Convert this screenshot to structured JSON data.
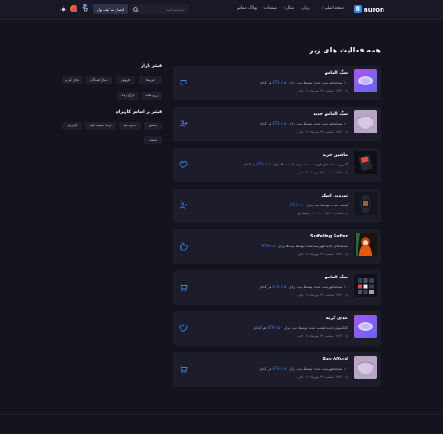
{
  "header": {
    "logo_letter": "N",
    "logo_text": "nuron",
    "nav": [
      "صفحه اصلی",
      "درباره",
      "مثال",
      "صفحات",
      "وبلاگ",
      "تماس"
    ],
    "search_placeholder": "جستجو بکنید",
    "wallet_button": "اتصال به کیف پول",
    "cart_count": "0"
  },
  "page_title": "همه فعالیت های زیر",
  "activities": [
    {
      "title": "سگ الماس",
      "desc_pre": "۱۰ نسخه فهرست شده توسط بیت برای ",
      "price": "ETH ۲.۵۰",
      "desc_post": " هر کدام",
      "date": "۲۹ مهرماه",
      "time": "۱۹:۳۰ دسامبر",
      "user": "جانی",
      "icon": "chat-icon"
    },
    {
      "title": "سگ الماس جدید",
      "desc_pre": "۱۰ نسخه فهرست شده توسط بیت برای ",
      "price": "ETH ۲.۵۰",
      "desc_post": " هر کدام",
      "date": "۲۹ مهرماه",
      "time": "۱۹:۳۰ دسامبر",
      "user": "جانی",
      "icon": "add-user-icon"
    },
    {
      "title": "ماشین خرید",
      "desc_pre": "آخرین نسخه های فهرست شده توسط بیت ها برای ",
      "price": "ETH ۲.۵۰",
      "desc_post": " هر کدام",
      "date": "۲۹ مهرماه",
      "time": "۱۹:۳۰ دسامبر",
      "user": "جانی",
      "icon": "heart-icon"
    },
    {
      "title": "توروین اسکر",
      "desc_pre": "لیست شده توسط بیت برای ",
      "price": "ETH ۲.۵۰",
      "desc_post": "",
      "date": "ساعت ۲۰ آبان ۱۴۰۰",
      "time": "",
      "user": "جانیسر تو",
      "icon": "add-user-icon"
    },
    {
      "title": "Suffeling Saffer",
      "desc_pre": "نسخه‌های جدید فهرست‌شده توسط بیت‌ها برای ",
      "price": "ETH ۲.۵۰",
      "desc_post": "",
      "date": "۲۹ مهرماه",
      "time": "۱۹:۳۰ دسامبر",
      "user": "جانی",
      "icon": "like-icon"
    },
    {
      "title": "سگ الماس",
      "desc_pre": "۱۰ نسخه فهرست شده توسط بیت برای ",
      "price": "ETH ۲.۵۰",
      "desc_post": " هر کدام",
      "date": "۲۹ مهرماه",
      "time": "۱۹:۳۰ دسامبر",
      "user": "جانی",
      "icon": "cart-icon"
    },
    {
      "title": "غذای گربه",
      "desc_pre": "کلکسیون جدید لیست شده توسط بیت برای ",
      "price": "ETH ۲.۵۰",
      "desc_post": " هر کدام",
      "date": "۲۹ مهرماه",
      "time": "۱۹:۳۰ دسامبر",
      "user": "جانی",
      "icon": "heart-icon"
    },
    {
      "title": "Sun Afford",
      "desc_pre": "۱۰ نسخه فهرست شده توسط بیت برای ",
      "price": "ETH ۲.۵۰",
      "desc_post": " هر کدام",
      "date": "۲۹ مهرماه",
      "time": "۱۹:۳۰ دسامبر",
      "user": "جانی",
      "icon": "cart-icon"
    }
  ],
  "filters": {
    "market_title": "فیلتر بازار",
    "market_chips": [
      "خریدها",
      "فروش",
      "دنبال کنندگان",
      "دنبال کردن",
      "رزرو شده",
      "حراج زنده"
    ],
    "user_title": "فیلتر بر اساس کاربران",
    "user_chips": [
      "عاشق",
      "ذخیره شد",
      "از ما حمایت کنید",
      "گزارش",
      "نتیجه"
    ]
  },
  "colors": {
    "accent": "#3b82f6",
    "background": "#14141f",
    "card": "#1c1c2a"
  }
}
